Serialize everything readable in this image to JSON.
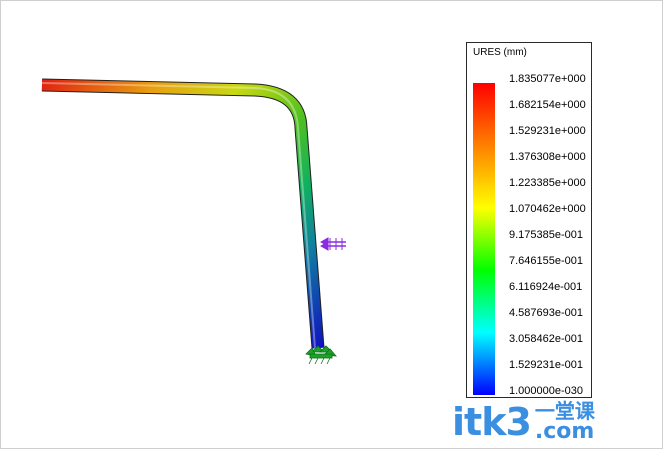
{
  "legend": {
    "title": "URES (mm)",
    "labels": [
      "1.835077e+000",
      "1.682154e+000",
      "1.529231e+000",
      "1.376308e+000",
      "1.223385e+000",
      "1.070462e+000",
      "9.175385e-001",
      "7.646155e-001",
      "6.116924e-001",
      "4.587693e-001",
      "3.058462e-001",
      "1.529231e-001",
      "1.000000e-030"
    ],
    "colors": [
      "#ff0000",
      "#ff8000",
      "#ffff00",
      "#00ff00",
      "#00ffff",
      "#0000ff"
    ]
  },
  "watermark": {
    "main": "itk3",
    "cn": "一堂课",
    "com": ".com"
  }
}
